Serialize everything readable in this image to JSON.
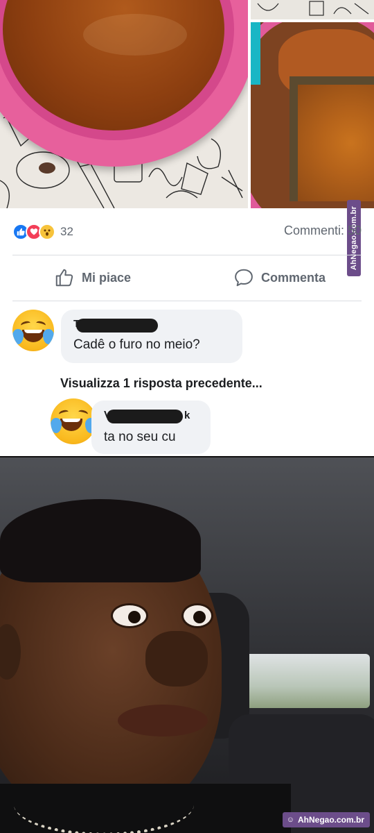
{
  "post": {
    "reactions": {
      "icons": [
        "like-icon",
        "love-icon",
        "wow-icon"
      ],
      "count": "32"
    },
    "comments_count": "Commenti: 50",
    "actions": {
      "like_label": "Mi piace",
      "comment_label": "Commenta"
    }
  },
  "comments": [
    {
      "author_visible_prefix": "T",
      "text": "Cadê o furo no meio?"
    },
    {
      "author_visible_prefix": "V",
      "author_visible_suffix": "k",
      "text": "ta no seu cu"
    }
  ],
  "view_previous_replies": "Visualizza 1 risposta precedente...",
  "watermark": {
    "side": "AhNegao.com.br",
    "bottom": "AhNegao.com.br"
  },
  "colors": {
    "like_blue": "#1877f2",
    "love_red": "#f33e58",
    "watermark_purple": "#6c4d8a",
    "bubble_bg": "#f0f2f5"
  }
}
